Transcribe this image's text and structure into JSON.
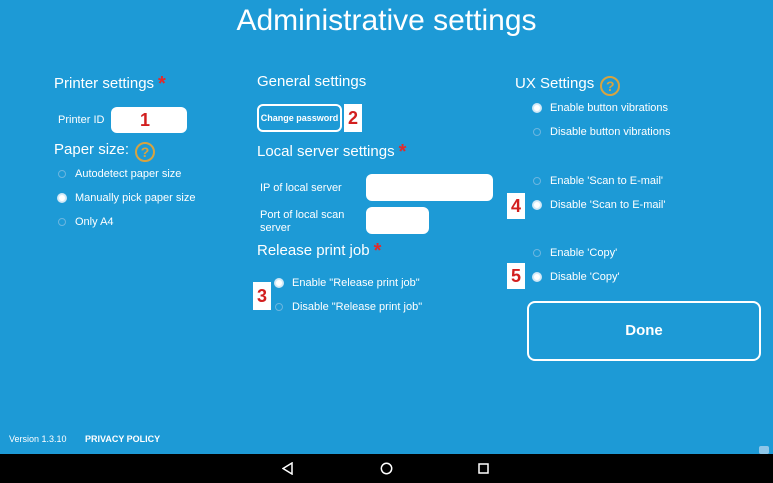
{
  "title": "Administrative settings",
  "printer": {
    "heading": "Printer settings",
    "printer_id_label": "Printer ID",
    "printer_id_value": ""
  },
  "paper": {
    "heading": "Paper size:",
    "options": [
      {
        "label": "Autodetect paper size",
        "checked": false
      },
      {
        "label": "Manually pick paper size",
        "checked": true
      },
      {
        "label": "Only A4",
        "checked": false
      }
    ]
  },
  "general": {
    "heading": "General settings",
    "change_password_label": "Change password"
  },
  "local_server": {
    "heading": "Local server settings",
    "ip_label": "IP of local server",
    "port_label": "Port of local scan server"
  },
  "release": {
    "heading": "Release print job",
    "options": [
      {
        "label": "Enable \"Release print job\"",
        "checked": true
      },
      {
        "label": "Disable \"Release print job\"",
        "checked": false
      }
    ]
  },
  "ux": {
    "heading": "UX Settings",
    "vibration_options": [
      {
        "label": "Enable button vibrations",
        "checked": true
      },
      {
        "label": "Disable button vibrations",
        "checked": false
      }
    ],
    "scan_email_options": [
      {
        "label": "Enable 'Scan to E-mail'",
        "checked": false
      },
      {
        "label": "Disable 'Scan to E-mail'",
        "checked": true
      }
    ],
    "copy_options": [
      {
        "label": "Enable 'Copy'",
        "checked": false
      },
      {
        "label": "Disable 'Copy'",
        "checked": true
      }
    ],
    "done_label": "Done"
  },
  "badges": [
    "1",
    "2",
    "3",
    "4",
    "5"
  ],
  "footer": {
    "version": "Version 1.3.10",
    "privacy": "PRIVACY POLICY"
  },
  "icons": {
    "star": "*",
    "help": "?"
  },
  "colors": {
    "background": "#1d9ad6",
    "accent_star": "#e22a2a",
    "help_icon": "#d6a341"
  }
}
